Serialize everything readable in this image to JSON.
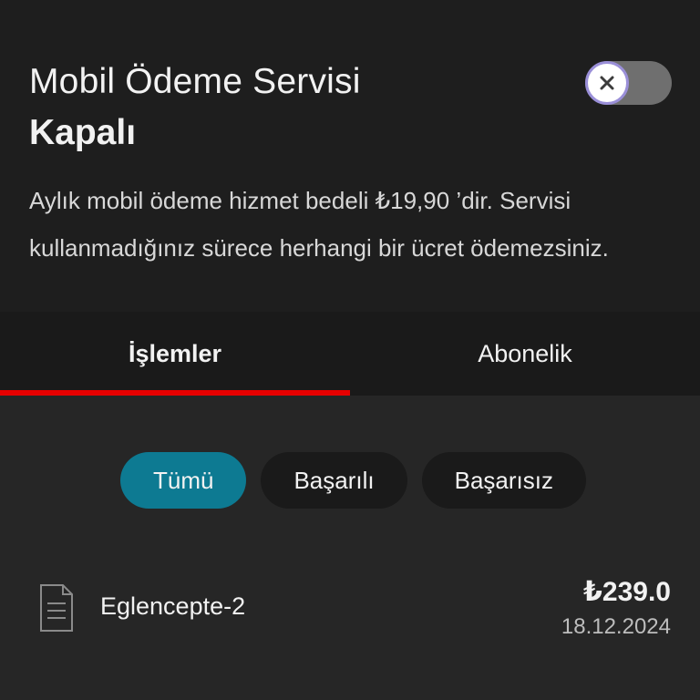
{
  "service": {
    "title": "Mobil Ödeme Servisi",
    "status": "Kapalı",
    "toggle_state": "off",
    "description": "Aylık mobil ödeme hizmet bedeli ₺19,90 ’dir. Servisi kullanmadığınız sürece herhangi bir ücret ödemezsiniz."
  },
  "tabs": [
    {
      "label": "İşlemler",
      "active": true
    },
    {
      "label": "Abonelik",
      "active": false
    }
  ],
  "filters": [
    {
      "label": "Tümü",
      "selected": true
    },
    {
      "label": "Başarılı",
      "selected": false
    },
    {
      "label": "Başarısız",
      "selected": false
    }
  ],
  "transactions": [
    {
      "name": "Eglencepte-2",
      "amount": "₺239.0",
      "date": "18.12.2024",
      "icon": "document-icon"
    }
  ],
  "colors": {
    "accent": "#e60000",
    "chip_selected": "#0d7a92",
    "background": "#1e1e1e"
  }
}
